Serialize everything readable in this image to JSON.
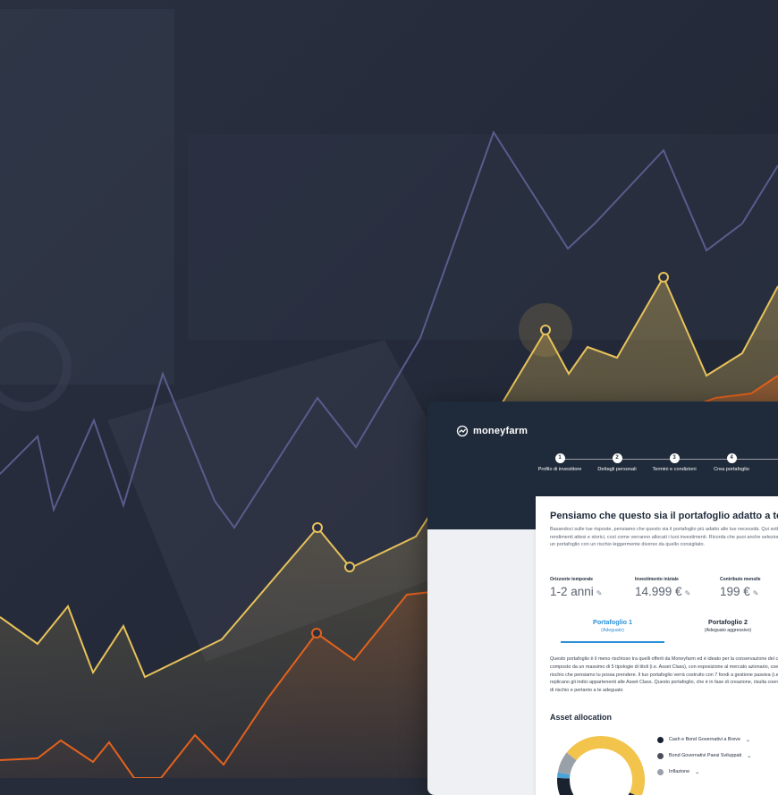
{
  "brand": {
    "name": "moneyfarm"
  },
  "colors": {
    "navy": "#1f2a3a",
    "accent_blue": "#2a8fd6",
    "chart_purple": "#5a5c8c",
    "chart_yellow": "#e8c25a",
    "chart_orange": "#e2621e",
    "donut_yellow": "#f2c44c",
    "donut_dark": "#1a2230",
    "donut_grey": "#9aa0a8",
    "donut_blue": "#4aa3d8"
  },
  "steps": [
    {
      "number": "1",
      "label": "Profilo di investitore"
    },
    {
      "number": "2",
      "label": "Dettagli personali"
    },
    {
      "number": "3",
      "label": "Termini e condizioni"
    },
    {
      "number": "4",
      "label": "Crea portafoglio"
    }
  ],
  "panel": {
    "title": "Pensiamo che questo sia il portafoglio adatto a te",
    "intro": "Basandoci sulle tue risposte, pensiamo che questo sia il portafoglio più adatto alle tue necessità. Qui sotto potrai vedere i rendimenti attesi e storici, così come verranno allocati i tuoi investimenti. Ricorda che puoi anche selezionare e confermare un portafoglio con un rischio leggermente diverso da quello consigliato.",
    "stats": [
      {
        "label": "Orizzonte temporale",
        "value": "1-2 anni"
      },
      {
        "label": "Investimento iniziale",
        "value": "14.999 €"
      },
      {
        "label": "Contributo mensile",
        "value": "199 €"
      }
    ],
    "tabs": [
      {
        "name": "Portafoglio 1",
        "sub": "(Adeguato)",
        "active": true
      },
      {
        "name": "Portafoglio 2",
        "sub": "(Adeguato aggressivo)",
        "active": false
      }
    ],
    "description": "Questo portafoglio è il meno rischioso tra quelli offerti da Moneyfarm ed è ideato per la conservazione del capitale. È composto da un massimo di 5 tipologie di titoli (i.e. Asset Class), con esposizione al mercato azionario, coerentemente con il rischio che pensiamo tu possa prendere. Il tuo portafoglio verrà costruito con 7 fondi a gestione passiva (i.e. ETF) che replicano gli indici appartenenti alle Asset Class. Questo portafoglio, che è in fase di creazione, risulta coerente al tuo profilo di rischio e pertanto a te adeguato",
    "section_title": "Asset allocation",
    "legend": [
      {
        "label": "Cash e Bond Governativi a Breve",
        "color": "#1a2230"
      },
      {
        "label": "Bond Governativi Paesi Sviluppati",
        "color": "#4a4f57"
      },
      {
        "label": "Inflazione",
        "color": "#9aa0a8"
      }
    ],
    "donut": [
      {
        "name": "yellow",
        "value": 0.46,
        "color": "#f2c44c"
      },
      {
        "name": "dark",
        "value": 0.44,
        "color": "#1a2230"
      },
      {
        "name": "blue",
        "value": 0.02,
        "color": "#4aa3d8"
      },
      {
        "name": "grey",
        "value": 0.08,
        "color": "#9aa0a8"
      }
    ]
  }
}
